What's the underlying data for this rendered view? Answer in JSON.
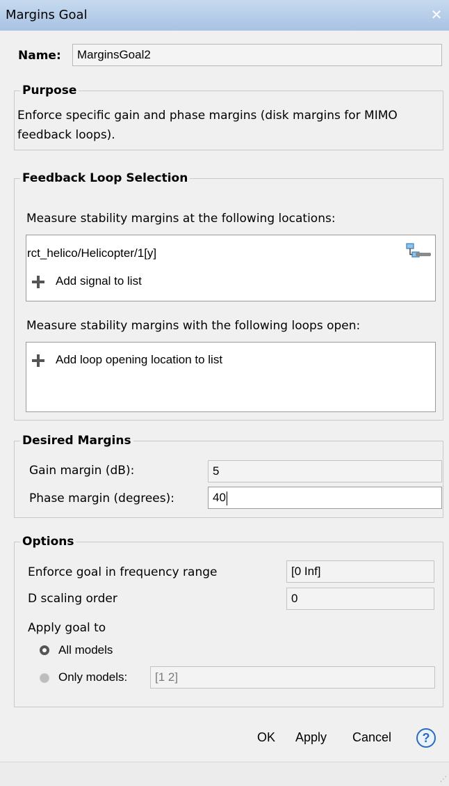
{
  "window": {
    "title": "Margins Goal",
    "close_glyph": "✕"
  },
  "name_field": {
    "label": "Name:",
    "value": "MarginsGoal2"
  },
  "purpose": {
    "legend": "Purpose",
    "text": "Enforce specific gain and phase margins (disk margins for MIMO feedback loops)."
  },
  "feedback": {
    "legend": "Feedback Loop Selection",
    "locations_label": "Measure stability margins at the following locations:",
    "locations": [
      "rct_helico/Helicopter/1[y]"
    ],
    "add_signal": "Add signal to list",
    "openings_label": "Measure stability margins with the following loops open:",
    "add_opening": "Add loop opening location to list"
  },
  "desired": {
    "legend": "Desired Margins",
    "gain_label": "Gain margin (dB):",
    "gain_value": "5",
    "phase_label": "Phase margin (degrees):",
    "phase_value": "40"
  },
  "options": {
    "legend": "Options",
    "freq_label": "Enforce goal in frequency range",
    "freq_value": "[0 Inf]",
    "dscale_label": "D scaling order",
    "dscale_value": "0",
    "apply_label": "Apply goal to",
    "all_models": "All models",
    "only_models": "Only models:",
    "only_models_value": "[1 2]",
    "selected": "All models"
  },
  "buttons": {
    "ok": "OK",
    "apply": "Apply",
    "cancel": "Cancel",
    "help": "?"
  },
  "icons": {
    "close": "close-icon",
    "add": "plus-icon",
    "remove": "minus-icon",
    "highlight": "signal-highlight-icon",
    "help": "help-icon"
  },
  "colors": {
    "titlebar": "#b8cfea",
    "help": "#2a6bc0"
  }
}
